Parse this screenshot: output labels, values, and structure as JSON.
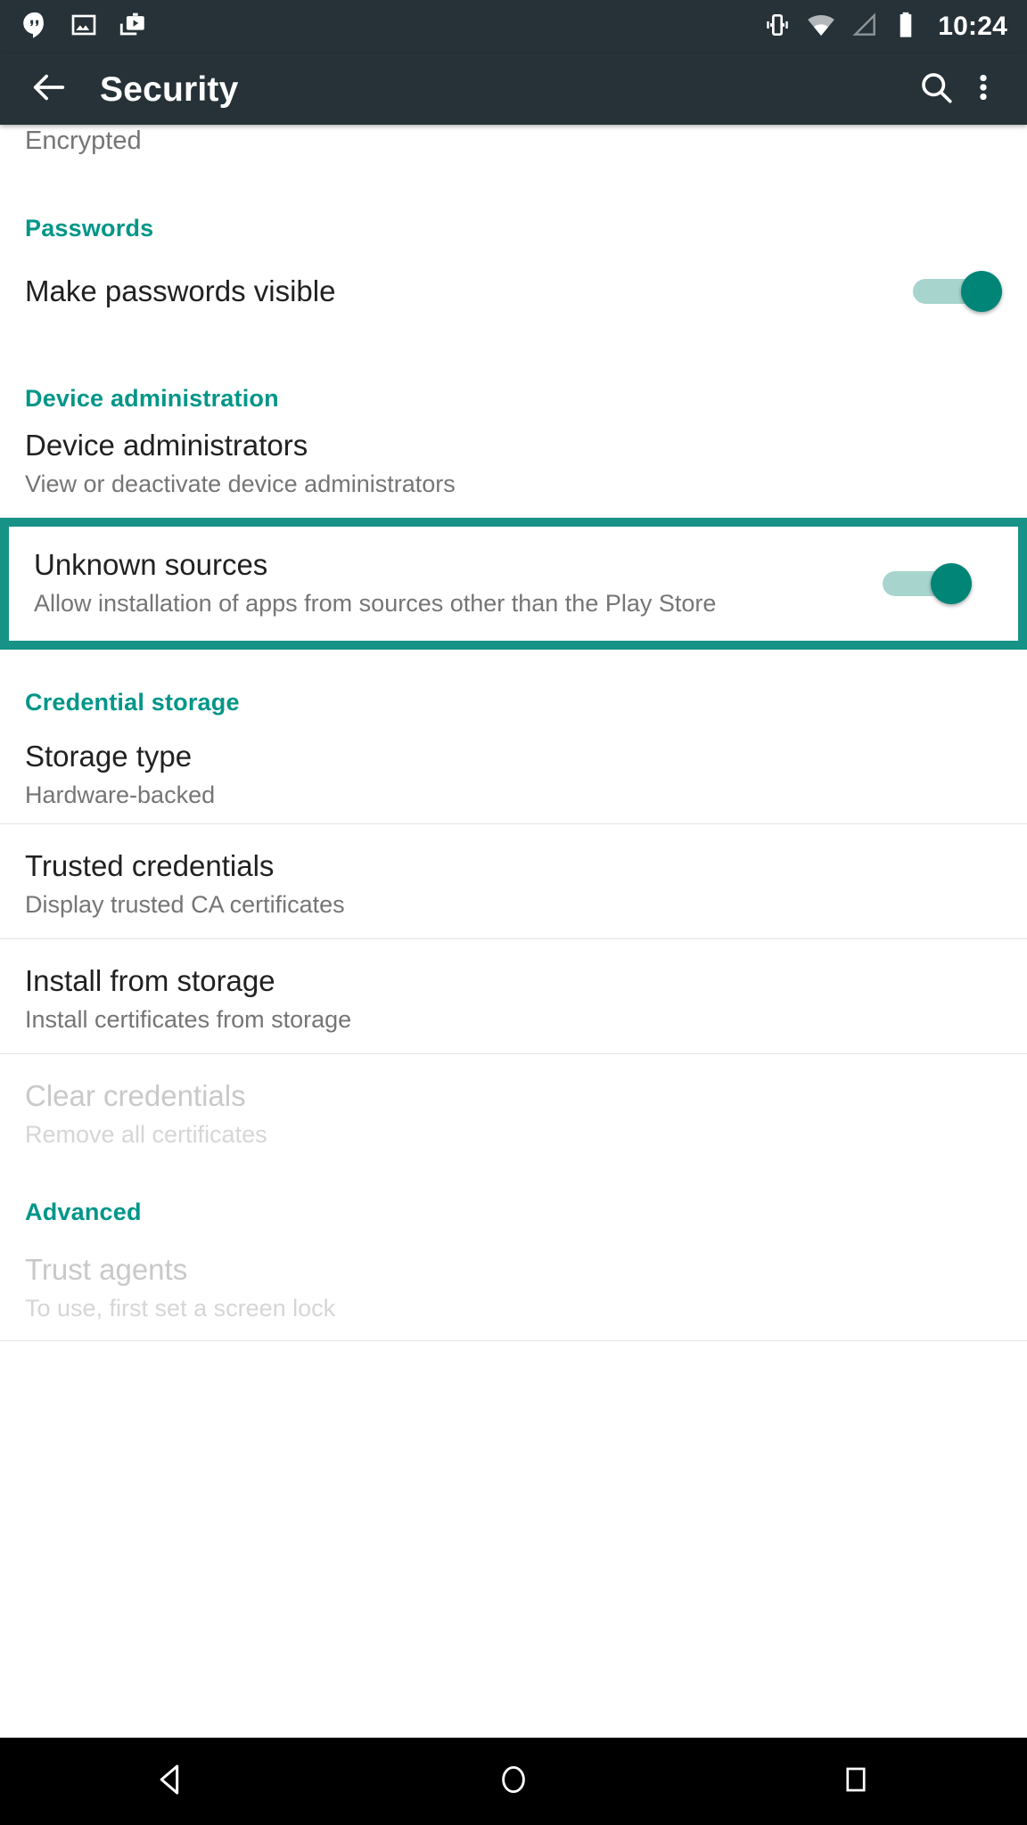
{
  "status_bar": {
    "time": "10:24",
    "notification_icons": [
      "hangouts-icon",
      "photo-icon",
      "play-media-icon"
    ],
    "system_icons": [
      "vibrate-icon",
      "wifi-icon",
      "cellular-signal-icon",
      "battery-icon"
    ],
    "background_color": "#263238"
  },
  "app_bar": {
    "title": "Security",
    "back_icon": "back-arrow-icon",
    "search_icon": "search-icon",
    "overflow_icon": "overflow-menu-icon",
    "background_color": "#263238"
  },
  "content": {
    "cut_off_subtitle": "Encrypted",
    "accent_color": "#009688",
    "highlight_color": "#179287",
    "sections": [
      {
        "header": "Passwords",
        "rows": [
          {
            "title": "Make passwords visible",
            "subtitle": "",
            "control": "switch",
            "switch_state": "on"
          }
        ]
      },
      {
        "header": "Device administration",
        "rows": [
          {
            "title": "Device administrators",
            "subtitle": "View or deactivate device administrators",
            "control": "none"
          },
          {
            "title": "Unknown sources",
            "subtitle": "Allow installation of apps from sources other than the Play Store",
            "control": "switch",
            "switch_state": "on",
            "highlighted": true
          }
        ]
      },
      {
        "header": "Credential storage",
        "rows": [
          {
            "title": "Storage type",
            "subtitle": "Hardware-backed",
            "control": "none"
          },
          {
            "title": "Trusted credentials",
            "subtitle": "Display trusted CA certificates",
            "control": "none"
          },
          {
            "title": "Install from storage",
            "subtitle": "Install certificates from storage",
            "control": "none"
          },
          {
            "title": "Clear credentials",
            "subtitle": "Remove all certificates",
            "control": "none",
            "disabled": true
          }
        ]
      },
      {
        "header": "Advanced",
        "rows": [
          {
            "title": "Trust agents",
            "subtitle": "To use, first set a screen lock",
            "control": "none",
            "disabled": true
          }
        ]
      }
    ]
  },
  "nav_bar": {
    "back_label": "back-nav-icon",
    "home_label": "home-nav-icon",
    "recents_label": "recents-nav-icon",
    "background_color": "#000000"
  }
}
